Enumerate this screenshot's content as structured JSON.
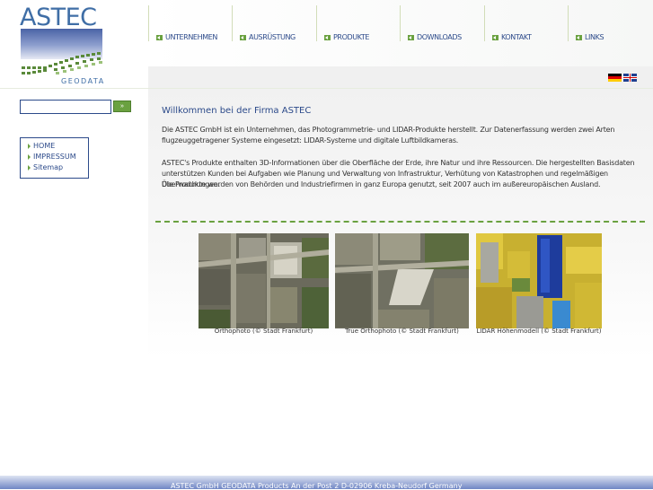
{
  "logo": {
    "title": "ASTEC",
    "subtitle": "GEODATA"
  },
  "nav": {
    "items": [
      {
        "label": "UNTERNEHMEN"
      },
      {
        "label": "AUSRÜSTUNG"
      },
      {
        "label": "PRODUKTE"
      },
      {
        "label": "DOWNLOADS"
      },
      {
        "label": "KONTAKT"
      },
      {
        "label": "LINKS"
      }
    ]
  },
  "languages": {
    "de": "german-flag-icon",
    "en": "english-flag-icon"
  },
  "search": {
    "value": "",
    "button_label": "»"
  },
  "sidebar": {
    "items": [
      {
        "label": "HOME"
      },
      {
        "label": "IMPRESSUM"
      },
      {
        "label": "Sitemap"
      }
    ]
  },
  "main": {
    "heading": "Willkommen bei der Firma ASTEC",
    "para1_line1": "Die ASTEC GmbH ist ein Unternehmen, das Photogrammetrie- und LIDAR-Produkte herstellt. Zur Datenerfassung werden zwei Arten",
    "para1_line2": "flugzeuggetragener Systeme eingesetzt:  LIDAR-Systeme und digitale Luftbildkameras.",
    "para2_line1": "ASTEC's Produkte enthalten 3D-Informationen über die Oberfläche der Erde, ihre Natur und ihre Ressourcen. Die hergestellten Basisdaten",
    "para2_line2": "unterstützen Kunden bei Aufgaben wie Planung und Verwaltung von Infrastruktur, Verhütung von Katastrophen und regelmäßigen Überwachungen.",
    "para2_line3": "Die Produkte werden von Behörden und Industriefirmen in ganz Europa genutzt, seit 2007 auch im außereuropäischen Ausland."
  },
  "gallery": [
    {
      "caption": "Orthophoto (© Stadt Frankfurt)"
    },
    {
      "caption": "True Orthophoto (© Stadt Frankfurt)"
    },
    {
      "caption": "LIDAR Höhenmodell (© Stadt Frankfurt)"
    }
  ],
  "footer": {
    "text": "ASTEC GmbH    GEODATA Products    An der Post 2    D-02906 Kreba-Neudorf    Germany"
  },
  "colors": {
    "accent_green": "#6aa140",
    "brand_blue": "#2c4a8a"
  }
}
